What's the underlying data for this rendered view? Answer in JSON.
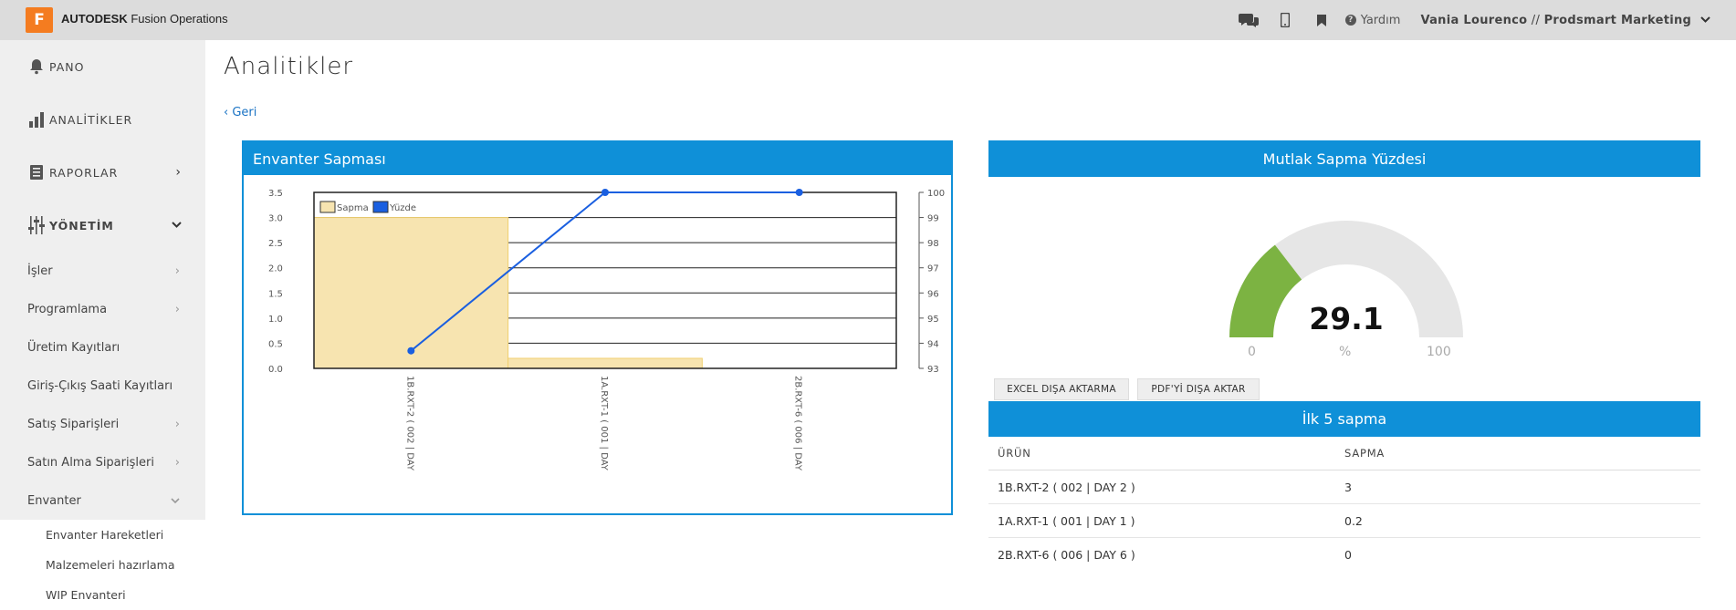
{
  "app": {
    "logo_letter": "F",
    "brand_bold": "AUTODESK",
    "brand_rest": "Fusion Operations",
    "help_label": "Yardım",
    "user_name": "Vania Lourenco",
    "user_sep": " // ",
    "user_org": "Prodsmart Marketing"
  },
  "sidebar": {
    "main": [
      {
        "label": "PANO",
        "icon": "bell-icon"
      },
      {
        "label": "ANALİTİKLER",
        "icon": "bar-chart-icon"
      },
      {
        "label": "RAPORLAR",
        "icon": "book-icon"
      },
      {
        "label": "YÖNETİM",
        "icon": "sliders-icon"
      }
    ],
    "sub": [
      "İşler",
      "Programlama",
      "Üretim Kayıtları",
      "Giriş-Çıkış Saati Kayıtları",
      "Satış Siparişleri",
      "Satın Alma Siparişleri",
      "Envanter"
    ],
    "sub3": [
      "Envanter Hareketleri",
      "Malzemeleri hazırlama",
      "WIP Envanteri"
    ]
  },
  "page": {
    "title": "Analitikler",
    "back_label": "‹ Geri"
  },
  "panel1": {
    "title": "Envanter Sapması"
  },
  "chart_data": {
    "type": "bar",
    "title": "Envanter Sapması",
    "categories": [
      "1B.RXT-2 ( 002 | DAY",
      "1A.RXT-1 ( 001 | DAY",
      "2B.RXT-6 ( 006 | DAY"
    ],
    "series": [
      {
        "name": "Sapma",
        "type": "bar",
        "axis": "left",
        "values": [
          3,
          0.2,
          0
        ],
        "color": "#f7e4b0"
      },
      {
        "name": "Yüzde",
        "type": "line",
        "axis": "right",
        "values": [
          93.7,
          100,
          100
        ],
        "color": "#1a5fe0"
      }
    ],
    "ylim_left": [
      0,
      3.5
    ],
    "yticks_left": [
      "0.0",
      "0.5",
      "1.0",
      "1.5",
      "2.0",
      "2.5",
      "3.0",
      "3.5"
    ],
    "ylim_right": [
      93,
      100
    ],
    "yticks_right": [
      "93",
      "94",
      "95",
      "96",
      "97",
      "98",
      "99",
      "100"
    ],
    "legend": "top-left",
    "grid": true
  },
  "panel2": {
    "title": "Mutlak Sapma Yüzdesi",
    "gauge_value": "29.1",
    "gauge_fraction": 0.291,
    "gauge_min": "0",
    "gauge_unit": "%",
    "gauge_max": "100",
    "gauge_color": "#7cb342"
  },
  "buttons": {
    "excel": "EXCEL DIŞA AKTARMA",
    "pdf": "PDF'Yİ DIŞA AKTAR"
  },
  "table": {
    "title": "İlk 5 sapma",
    "headers": [
      "ÜRÜN",
      "SAPMA"
    ],
    "rows": [
      [
        "1B.RXT-2 ( 002 | DAY 2 )",
        "3"
      ],
      [
        "1A.RXT-1 ( 001 | DAY 1 )",
        "0.2"
      ],
      [
        "2B.RXT-6 ( 006 | DAY 6 )",
        "0"
      ]
    ]
  }
}
